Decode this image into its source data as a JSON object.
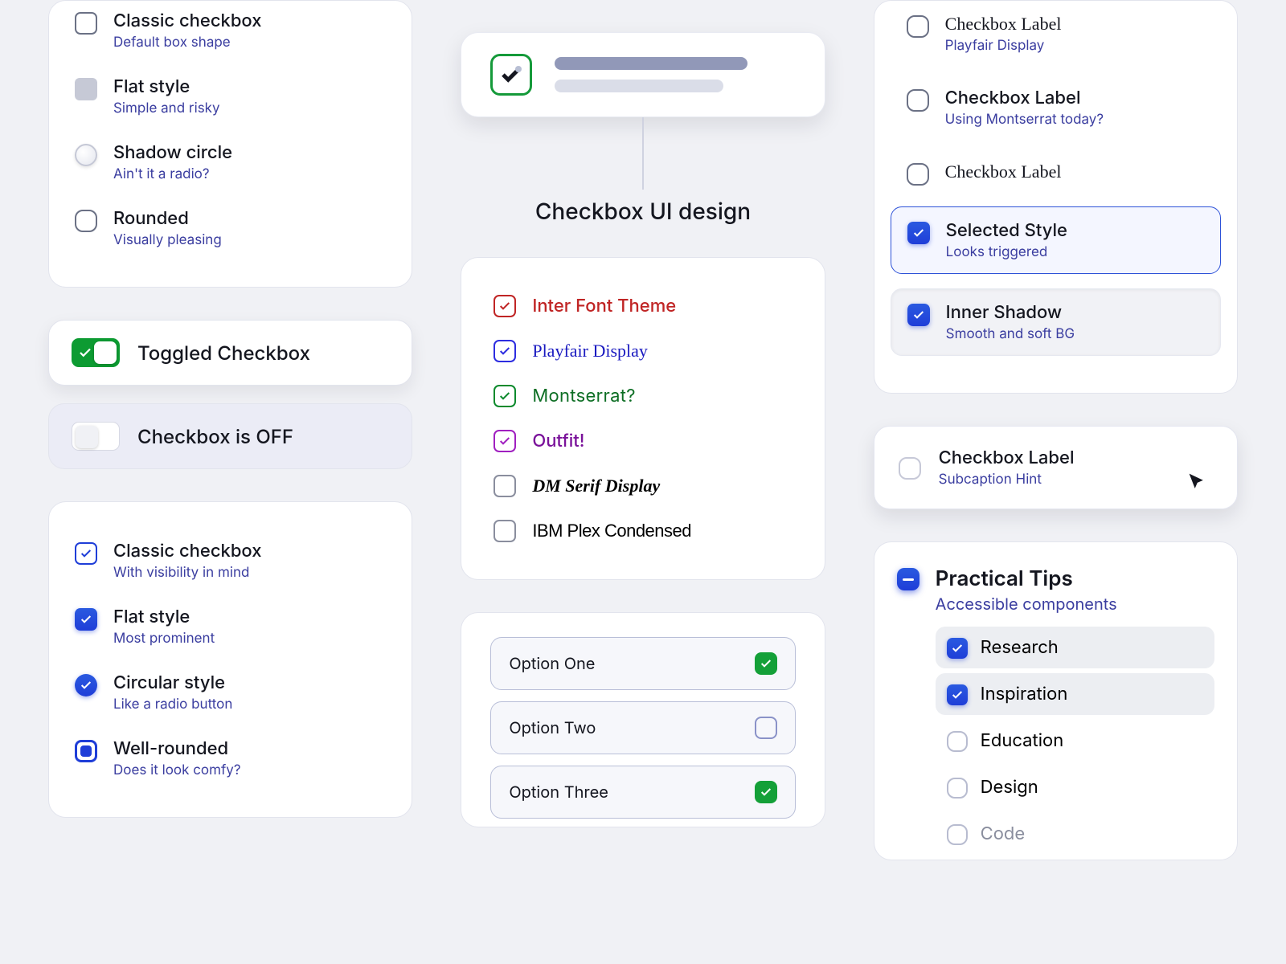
{
  "col1": {
    "styles_unchecked": [
      {
        "label": "Classic checkbox",
        "sub": "Default box shape"
      },
      {
        "label": "Flat style",
        "sub": "Simple and risky"
      },
      {
        "label": "Shadow circle",
        "sub": "Ain't it a radio?"
      },
      {
        "label": "Rounded",
        "sub": "Visually pleasing"
      }
    ],
    "toggle_on": "Toggled Checkbox",
    "toggle_off": "Checkbox is OFF",
    "styles_checked": [
      {
        "label": "Classic checkbox",
        "sub": "With visibility in mind"
      },
      {
        "label": "Flat style",
        "sub": "Most prominent"
      },
      {
        "label": "Circular style",
        "sub": "Like a radio button"
      },
      {
        "label": "Well-rounded",
        "sub": "Does it look comfy?"
      }
    ]
  },
  "hero": {
    "title": "Checkbox UI design"
  },
  "fonts": [
    {
      "label": "Inter Font Theme"
    },
    {
      "label": "Playfair Display"
    },
    {
      "label": "Montserrat?"
    },
    {
      "label": "Outfit!"
    },
    {
      "label": "DM Serif Display"
    },
    {
      "label": "IBM Plex Condensed"
    }
  ],
  "options": [
    {
      "label": "Option One",
      "on": true
    },
    {
      "label": "Option Two",
      "on": false
    },
    {
      "label": "Option Three",
      "on": true
    }
  ],
  "right_styles": [
    {
      "label": "Checkbox Label",
      "sub": "Playfair Display"
    },
    {
      "label": "Checkbox Label",
      "sub": "Using Montserrat today?"
    },
    {
      "label": "Checkbox Label",
      "sub": ""
    },
    {
      "label": "Selected Style",
      "sub": "Looks triggered"
    },
    {
      "label": "Inner Shadow",
      "sub": "Smooth and soft BG"
    }
  ],
  "hover": {
    "label": "Checkbox Label",
    "sub": "Subcaption Hint"
  },
  "tips": {
    "title": "Practical Tips",
    "sub": "Accessible components",
    "items": [
      {
        "label": "Research",
        "on": true
      },
      {
        "label": "Inspiration",
        "on": true
      },
      {
        "label": "Education",
        "on": false
      },
      {
        "label": "Design",
        "on": false
      },
      {
        "label": "Code",
        "on": false
      }
    ]
  }
}
